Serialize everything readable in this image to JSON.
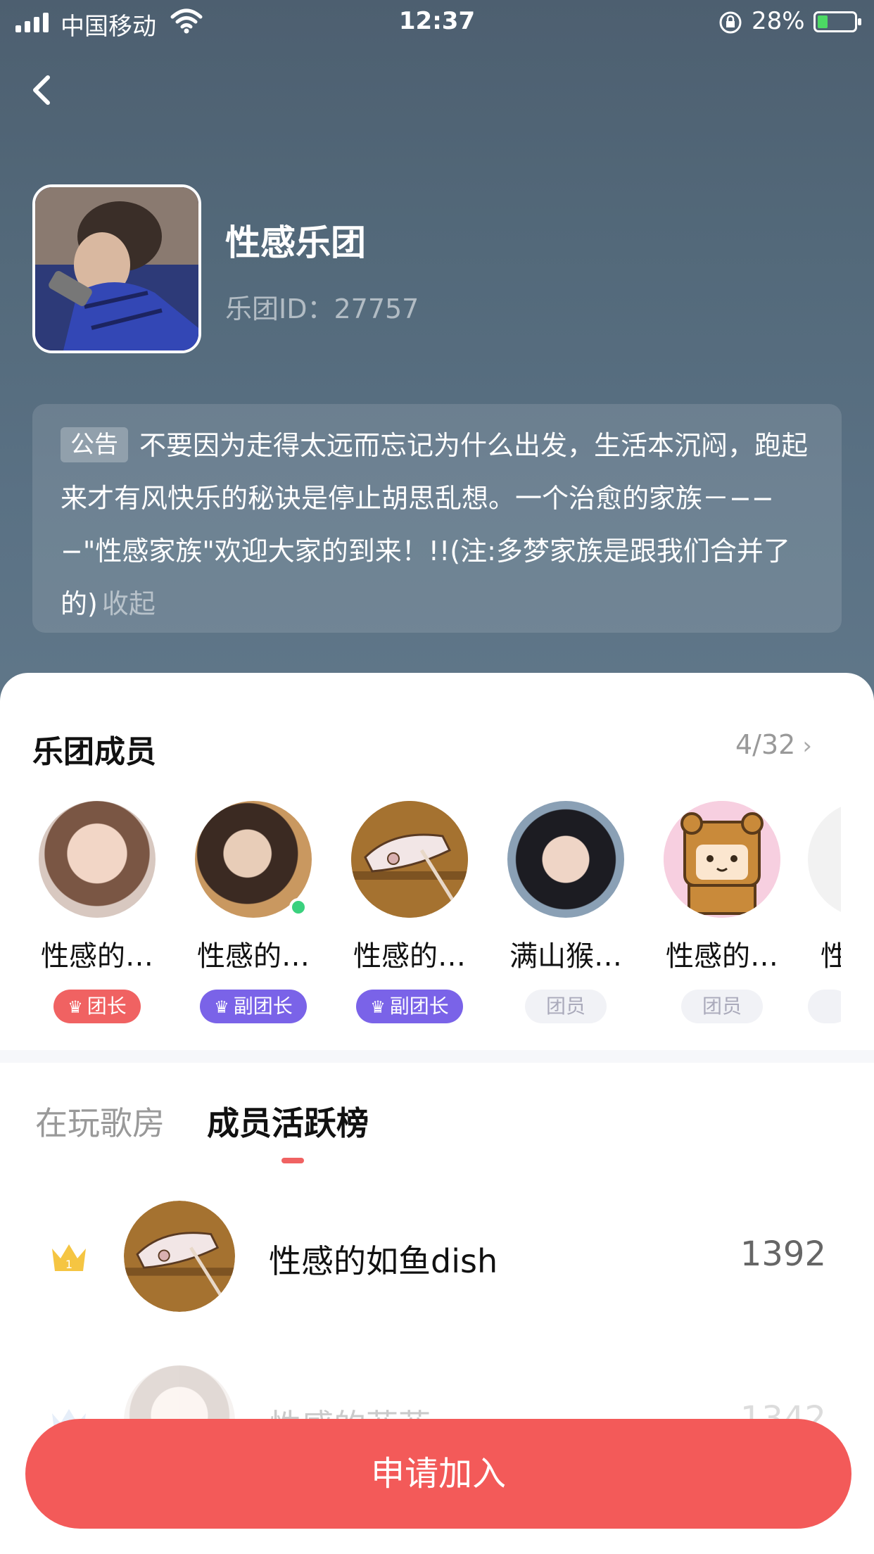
{
  "status_bar": {
    "carrier": "中国移动",
    "time": "12:37",
    "battery": "28%"
  },
  "group": {
    "name": "性感乐团",
    "id_text": "乐团ID：27757"
  },
  "notice": {
    "tag": "公告",
    "text": "不要因为走得太远而忘记为什么出发，生活本沉闷，跑起来才有风快乐的秘诀是停止胡思乱想。一个治愈的家族－−−−\"性感家族\"欢迎大家的到来！!!(注:多梦家族是跟我们合并了的)",
    "collapse": "收起"
  },
  "members": {
    "title": "乐团成员",
    "count": "4/32",
    "list": [
      {
        "name": "性感的…",
        "role": "团长",
        "online": false
      },
      {
        "name": "性感的…",
        "role": "副团长",
        "online": true
      },
      {
        "name": "性感的…",
        "role": "副团长",
        "online": false
      },
      {
        "name": "满山猴…",
        "role": "团员",
        "online": false
      },
      {
        "name": "性感的…",
        "role": "团员",
        "online": false
      },
      {
        "name": "性",
        "role": "",
        "online": false
      }
    ]
  },
  "tabs": {
    "playing": "在玩歌房",
    "ranking": "成员活跃榜"
  },
  "ranking": [
    {
      "rank": "1",
      "name": "性感的如鱼dish",
      "score": "1392"
    },
    {
      "rank": "2",
      "name": "性感的菲菲",
      "score": "1342"
    }
  ],
  "join_button": "申请加入",
  "colors": {
    "accent": "#f35a59",
    "leader_badge": "#f06262",
    "vice_badge": "#7a63e8",
    "online": "#3ad17e"
  }
}
